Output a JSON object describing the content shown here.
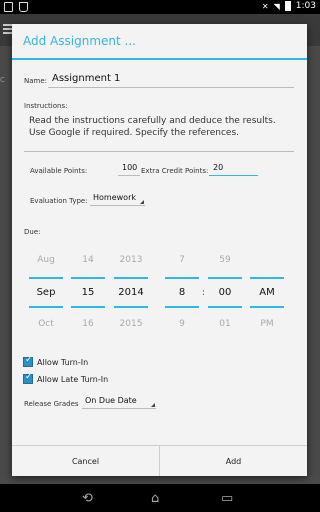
{
  "status": {
    "time": "1:03"
  },
  "background": {
    "tab_fragment": "C"
  },
  "dialog": {
    "title": "Add Assignment ...",
    "name_label": "Name:",
    "name_value": "Assignment 1",
    "instructions_label": "Instructions:",
    "instructions_value": "Read the instructions carefully and deduce the results. Use Google if required. Specify the references.",
    "available_points_label": "Available Points:",
    "available_points_value": "100",
    "extra_credit_label": "Extra Credit Points:",
    "extra_credit_value": "20",
    "evaluation_type_label": "Evaluation Type:",
    "evaluation_type_value": "Homework",
    "due_label": "Due:",
    "date_picker": {
      "month": {
        "prev": "Aug",
        "current": "Sep",
        "next": "Oct"
      },
      "day": {
        "prev": "14",
        "current": "15",
        "next": "16"
      },
      "year": {
        "prev": "2013",
        "current": "2014",
        "next": "2015"
      },
      "hour": {
        "prev": "7",
        "current": "8",
        "next": "9"
      },
      "minute": {
        "prev": "59",
        "current": "00",
        "next": "01"
      },
      "ampm": {
        "prev": "",
        "current": "AM",
        "next": "PM"
      },
      "separator": ":"
    },
    "allow_turn_in_label": "Allow Turn-In",
    "allow_turn_in_checked": true,
    "allow_late_turn_in_label": "Allow Late Turn-In",
    "allow_late_turn_in_checked": true,
    "release_grades_label": "Release Grades",
    "release_grades_value": "On Due Date",
    "cancel_label": "Cancel",
    "add_label": "Add"
  },
  "colors": {
    "accent": "#33b5e5",
    "checkbox": "#2a8fc2"
  },
  "icons": [
    "notification-icon",
    "flash-icon",
    "mute-icon",
    "wifi-icon",
    "battery-icon",
    "back-icon",
    "home-icon",
    "recents-icon"
  ]
}
